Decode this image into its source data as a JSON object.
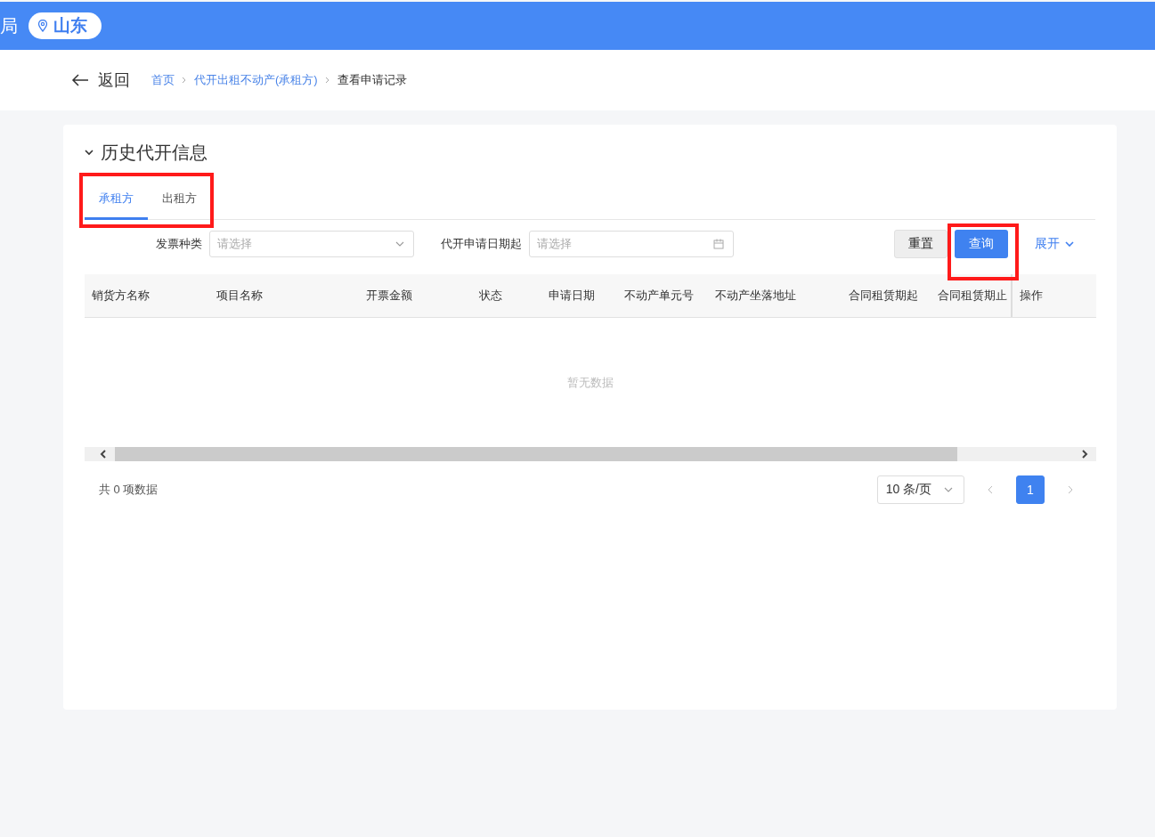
{
  "header": {
    "title_fragment": "局",
    "location": "山东"
  },
  "nav": {
    "back": "返回",
    "breadcrumbs": [
      {
        "label": "首页",
        "link": true
      },
      {
        "label": "代开出租不动产(承租方)",
        "link": true
      },
      {
        "label": "查看申请记录",
        "link": false
      }
    ]
  },
  "section": {
    "title": "历史代开信息",
    "expanded": true
  },
  "tabs": [
    {
      "label": "承租方",
      "selected": true
    },
    {
      "label": "出租方",
      "selected": false
    }
  ],
  "filters": [
    {
      "label": "发票种类",
      "placeholder": "请选择",
      "kind": "select"
    },
    {
      "label": "代开申请日期起",
      "placeholder": "请选择",
      "kind": "date"
    }
  ],
  "buttons": {
    "reset": "重置",
    "search": "查询",
    "expand": "展开"
  },
  "table": {
    "columns": [
      "销货方名称",
      "项目名称",
      "开票金额",
      "状态",
      "申请日期",
      "不动产单元号",
      "不动产坐落地址",
      "合同租赁期起",
      "合同租赁期止",
      "操作"
    ],
    "empty_text": "暂无数据"
  },
  "pagination": {
    "total": "共 0 项数据",
    "page_size": "10 条/页",
    "pages": [
      {
        "label": "1",
        "selected": true
      }
    ]
  },
  "annotations": {
    "tabs_highlighted": true,
    "search_highlighted": true
  }
}
